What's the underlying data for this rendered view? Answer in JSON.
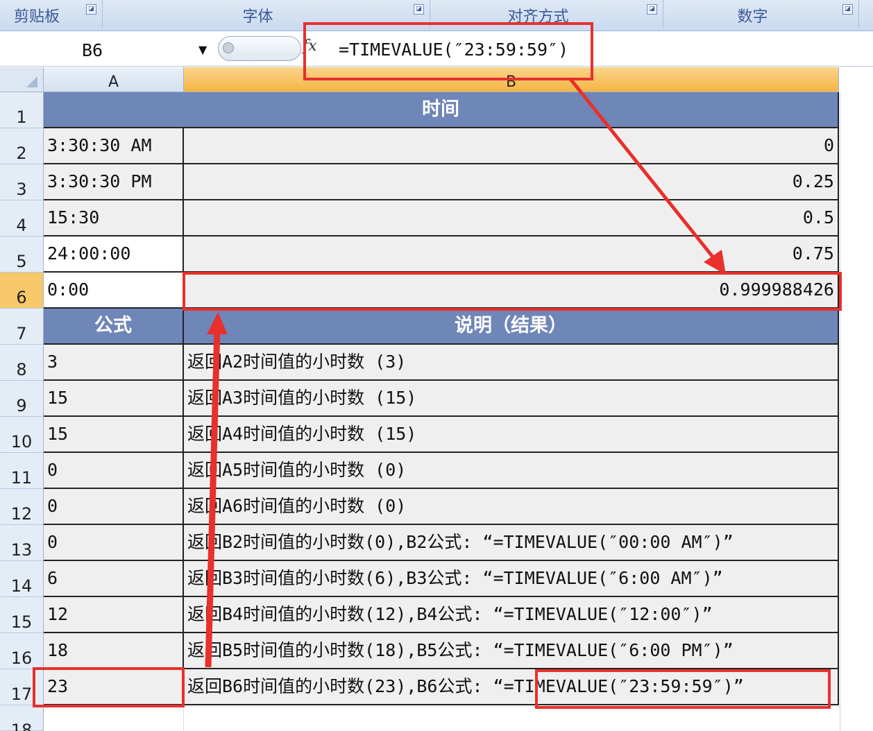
{
  "ribbon": {
    "groups": [
      {
        "label": "剪贴板"
      },
      {
        "label": "字体"
      },
      {
        "label": "对齐方式"
      },
      {
        "label": "数字"
      }
    ],
    "launcher_glyph": "◪"
  },
  "formula_bar": {
    "name_box": "B6",
    "fx": "fx",
    "formula": "=TIMEVALUE(″23:59:59″)"
  },
  "columns": [
    "A",
    "B"
  ],
  "rows": [
    {
      "n": "1",
      "a": "",
      "b": "时间",
      "style": "header-merged"
    },
    {
      "n": "2",
      "a": "3:30:30 AM",
      "b": "0"
    },
    {
      "n": "3",
      "a": "3:30:30 PM",
      "b": "0.25"
    },
    {
      "n": "4",
      "a": "15:30",
      "b": "0.5"
    },
    {
      "n": "5",
      "a": "24:00:00",
      "b": "0.75"
    },
    {
      "n": "6",
      "a": "0:00",
      "b": "0.999988426",
      "selected": true
    },
    {
      "n": "7",
      "a": "公式",
      "b": "说明（结果）",
      "style": "header"
    },
    {
      "n": "8",
      "a": "3",
      "b": "返回A2时间值的小时数 (3)"
    },
    {
      "n": "9",
      "a": "15",
      "b": "返回A3时间值的小时数 (15)"
    },
    {
      "n": "10",
      "a": "15",
      "b": "返回A4时间值的小时数 (15)"
    },
    {
      "n": "11",
      "a": "0",
      "b": "返回A5时间值的小时数 (0)"
    },
    {
      "n": "12",
      "a": "0",
      "b": "返回A6时间值的小时数 (0)"
    },
    {
      "n": "13",
      "a": "0",
      "b": "返回B2时间值的小时数(0),B2公式: “=TIMEVALUE(″00:00 AM″)”"
    },
    {
      "n": "14",
      "a": "6",
      "b": "返回B3时间值的小时数(6),B3公式: “=TIMEVALUE(″6:00 AM″)”"
    },
    {
      "n": "15",
      "a": "12",
      "b": "返回B4时间值的小时数(12),B4公式: “=TIMEVALUE(″12:00″)”"
    },
    {
      "n": "16",
      "a": "18",
      "b": "返回B5时间值的小时数(18),B5公式: “=TIMEVALUE(″6:00 PM″)”"
    },
    {
      "n": "17",
      "a": "23",
      "b": "返回B6时间值的小时数(23),B6公式: “=TIMEVALUE(″23:59:59″)”"
    },
    {
      "n": "18",
      "a": "",
      "b": ""
    }
  ],
  "colors": {
    "header_fill": "#6f86b8",
    "selected_column": "#f5b543",
    "annotation_red": "#e8302c",
    "cell_grey": "#efefef"
  }
}
